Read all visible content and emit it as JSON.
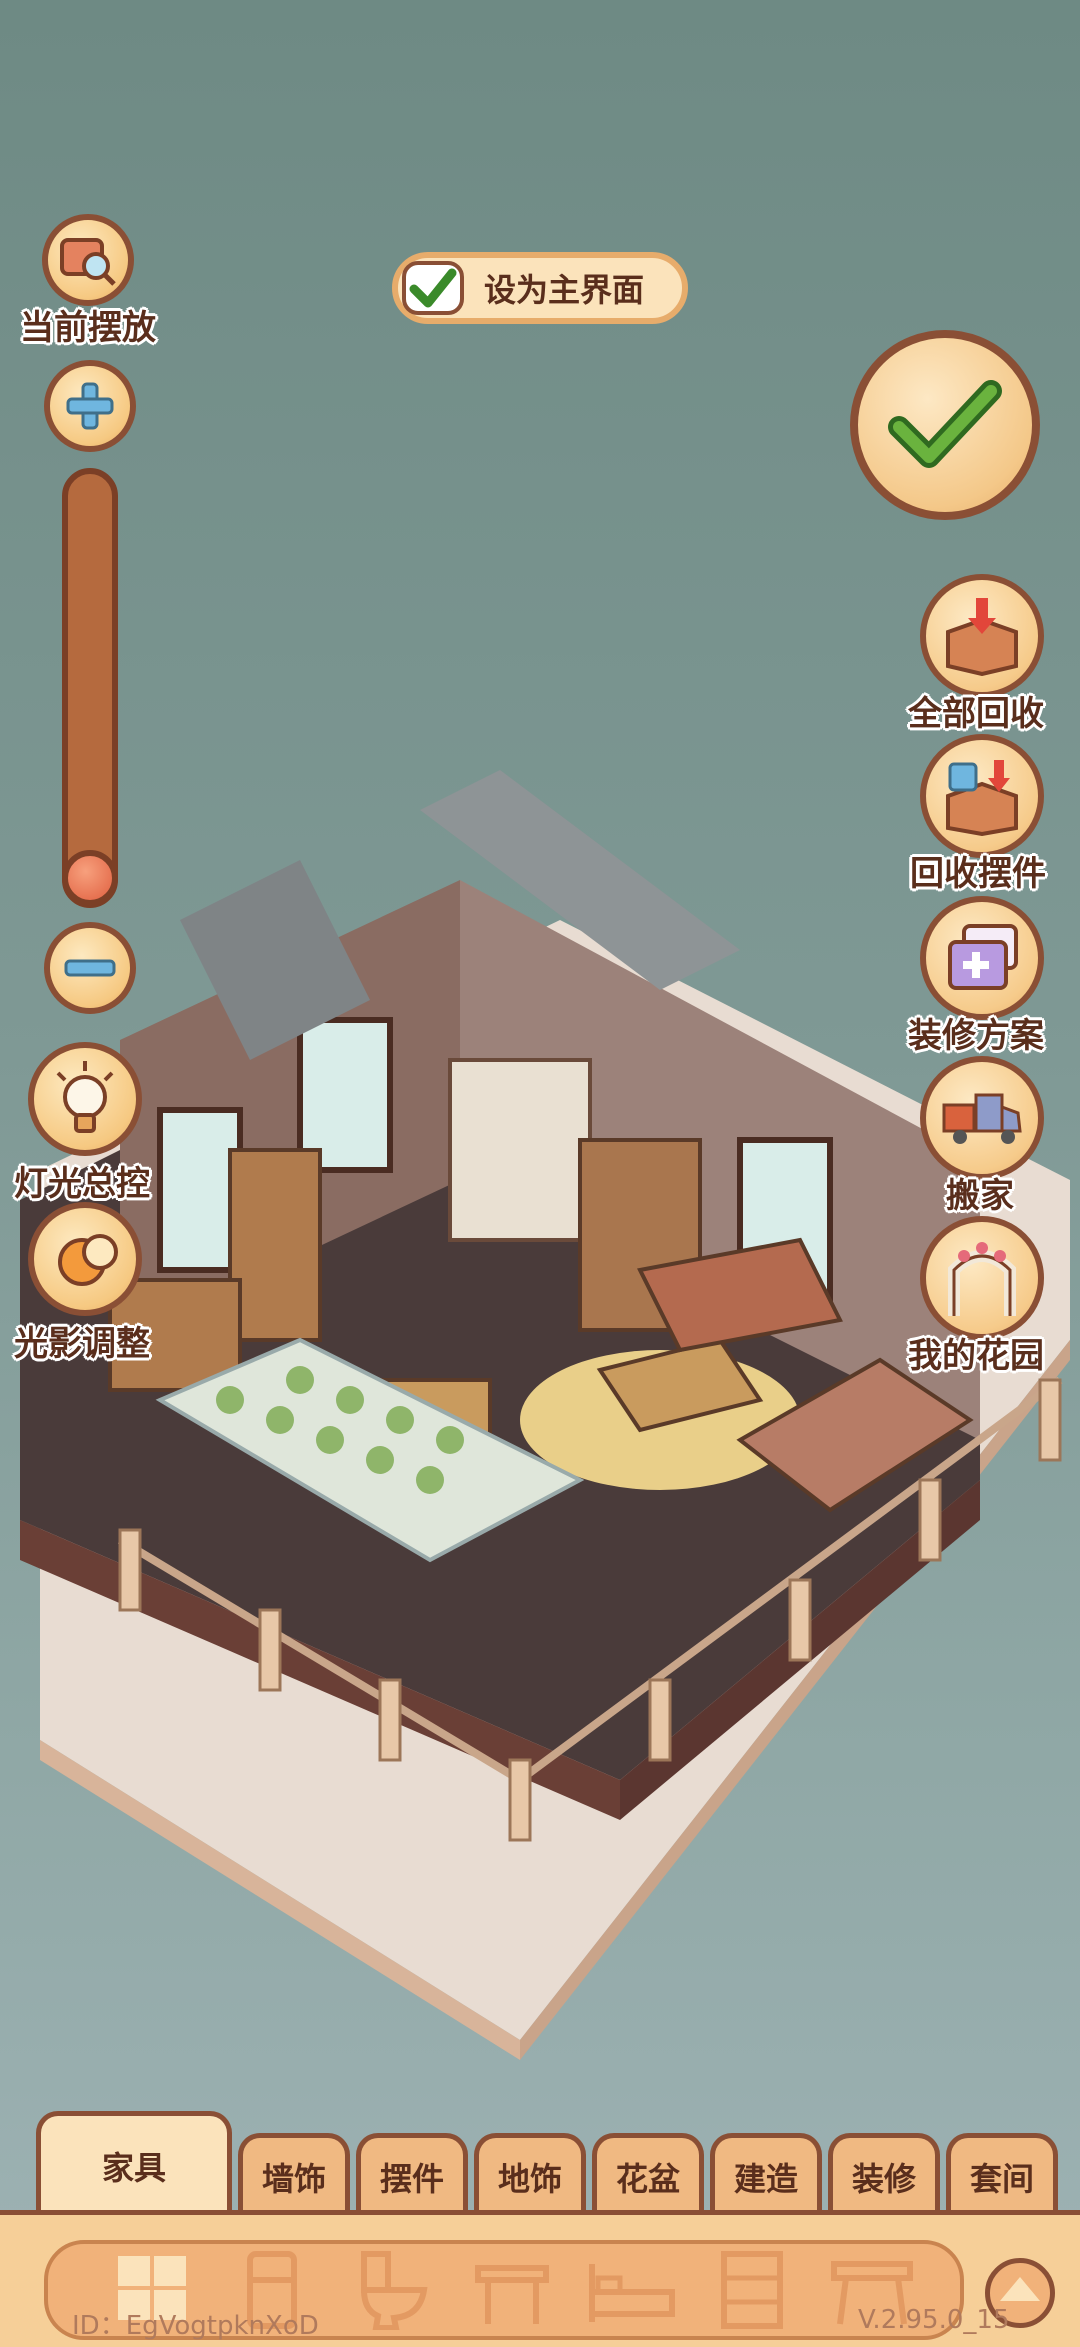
{
  "left_panel": {
    "current_placement_label": "当前摆放",
    "lighting_control_label": "灯光总控",
    "light_shadow_label": "光影调整"
  },
  "top": {
    "set_main_label": "设为主界面"
  },
  "right_panel": {
    "recycle_all_label": "全部回收",
    "recycle_decor_label": "回收摆件",
    "renovation_plan_label": "装修方案",
    "move_label": "搬家",
    "my_garden_label": "我的花园"
  },
  "tabs": [
    {
      "label": "家具"
    },
    {
      "label": "墙饰"
    },
    {
      "label": "摆件"
    },
    {
      "label": "地饰"
    },
    {
      "label": "花盆"
    },
    {
      "label": "建造"
    },
    {
      "label": "装修"
    },
    {
      "label": "套间"
    }
  ],
  "footer": {
    "player_id": "ID：EgVogtpknXoD",
    "version": "V.2.95.0_15"
  },
  "zoom_level": 0.05,
  "icons": [
    "magnifier-icon",
    "plus-icon",
    "minus-icon",
    "bulb-icon",
    "sun-moon-icon",
    "check-icon",
    "box-recycle-icon",
    "mug-recycle-icon",
    "plan-icon",
    "truck-icon",
    "garden-arch-icon",
    "grid-icon",
    "fridge-icon",
    "toilet-icon",
    "table-icon",
    "bed-icon",
    "cabinet-icon",
    "desk-icon",
    "chevron-up-icon"
  ]
}
